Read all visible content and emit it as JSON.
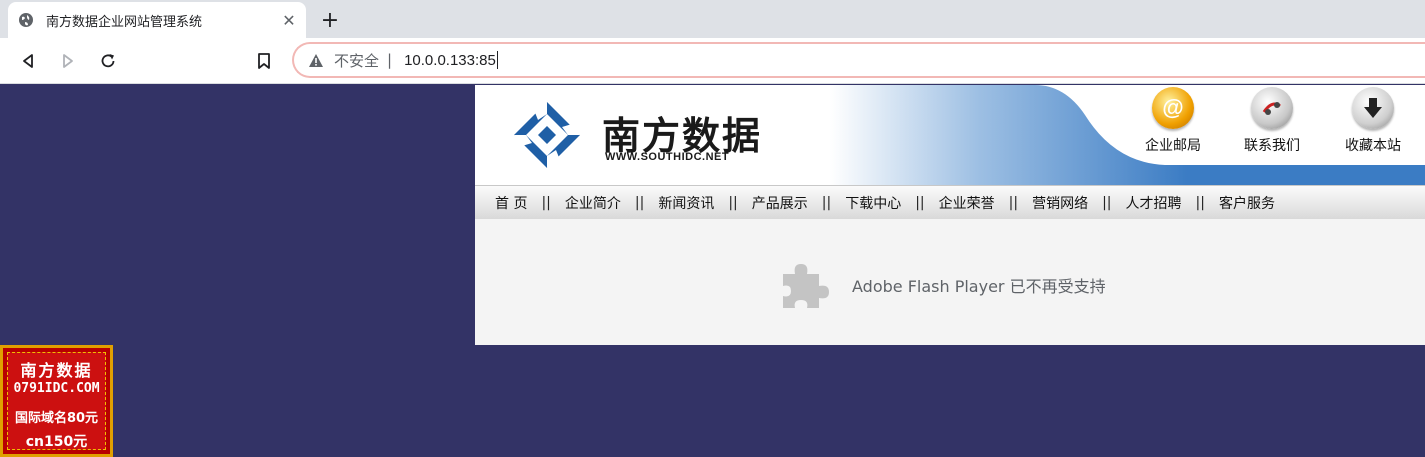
{
  "browser": {
    "tab_title": "南方数据企业网站管理系统",
    "tab_close": "✕",
    "new_tab": "+",
    "security_label": "不安全",
    "separator": "|",
    "url": "10.0.0.133:85"
  },
  "site": {
    "brand_cn": "南方数据",
    "brand_en": "WWW.SOUTHIDC.NET",
    "header_links": [
      {
        "label": "企业邮局",
        "icon": "email-icon"
      },
      {
        "label": "联系我们",
        "icon": "contact-icon"
      },
      {
        "label": "收藏本站",
        "icon": "bookmark-download-icon"
      }
    ],
    "nav": [
      "首 页",
      "企业简介",
      "新闻资讯",
      "产品展示",
      "下载中心",
      "企业荣誉",
      "营销网络",
      "人才招聘",
      "客户服务"
    ],
    "nav_separator": "||",
    "flash_message": "Adobe Flash Player 已不再受支持"
  },
  "ad": {
    "line1": "南方数据",
    "line2": "0791IDC.COM",
    "line3": "国际域名80元",
    "line4": "cn150元"
  },
  "colors": {
    "page_background": "#333366",
    "brand_blue": "#1f5fa6",
    "insecure_outline": "#f2b8b5"
  }
}
